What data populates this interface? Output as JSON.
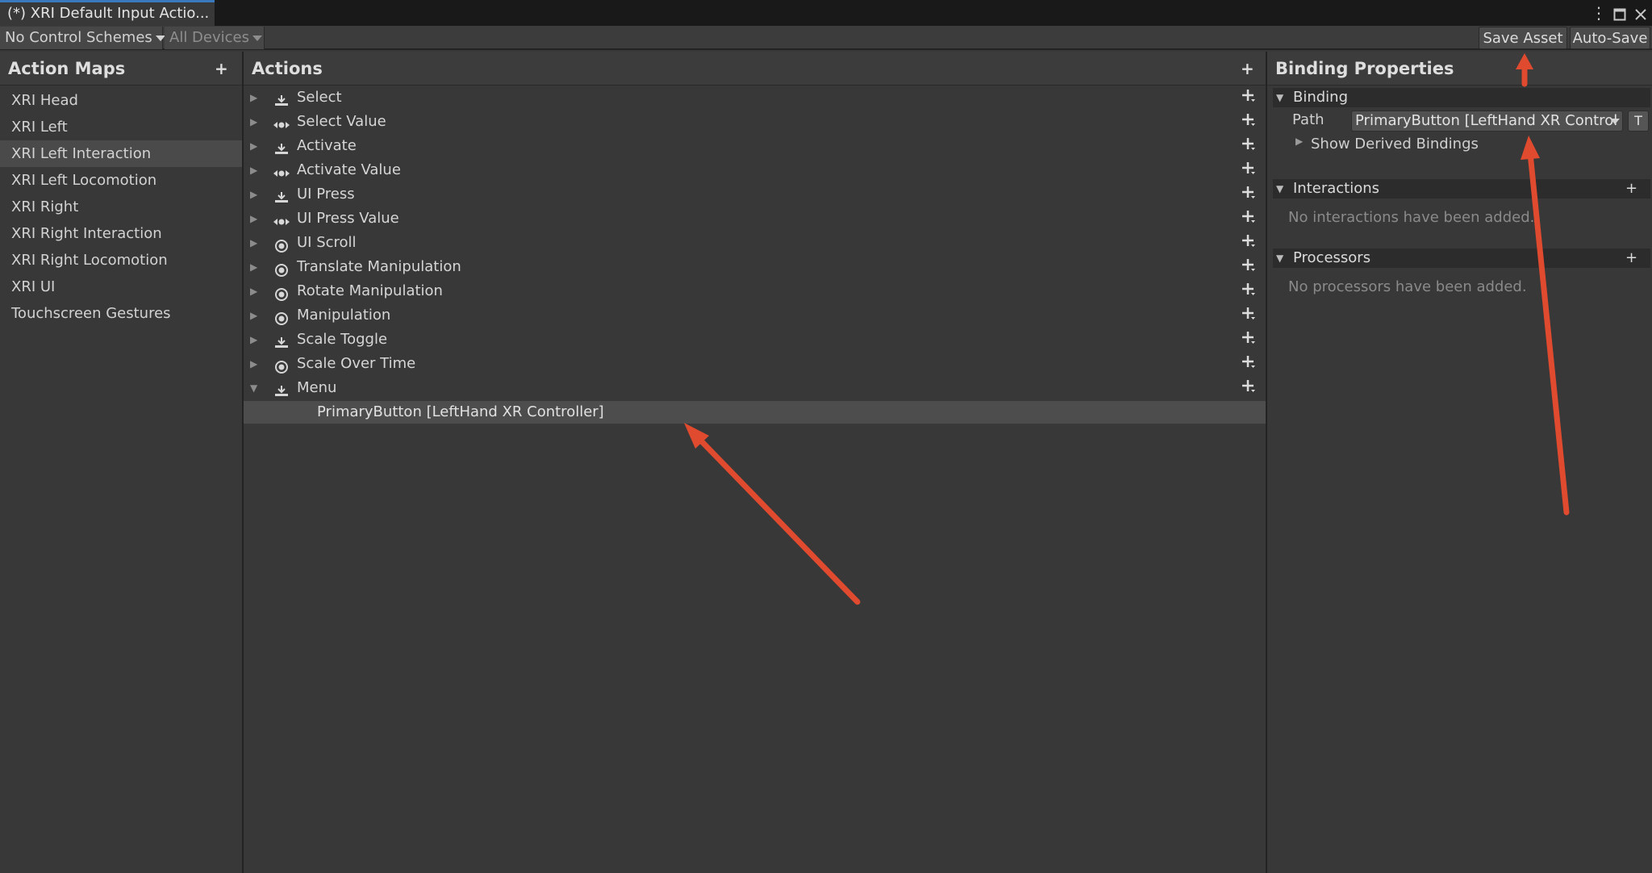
{
  "window": {
    "tab_title": "(*) XRI Default Input Actio...",
    "menu_icon": "kebab-menu-icon",
    "maximize_icon": "maximize-icon",
    "close_icon": "close-icon"
  },
  "toolbar": {
    "control_schemes": "No Control Schemes",
    "devices": "All Devices",
    "save_asset": "Save Asset",
    "auto_save": "Auto-Save"
  },
  "action_maps": {
    "title": "Action Maps",
    "add_label": "+",
    "items": [
      "XRI Head",
      "XRI Left",
      "XRI Left Interaction",
      "XRI Left Locomotion",
      "XRI Right",
      "XRI Right Interaction",
      "XRI Right Locomotion",
      "XRI UI",
      "Touchscreen Gestures"
    ],
    "selected_index": 2
  },
  "actions": {
    "title": "Actions",
    "add_label": "+",
    "items": [
      {
        "label": "Select",
        "icon": "button-icon",
        "expanded": false
      },
      {
        "label": "Select Value",
        "icon": "axis-icon",
        "expanded": false
      },
      {
        "label": "Activate",
        "icon": "button-icon",
        "expanded": false
      },
      {
        "label": "Activate Value",
        "icon": "axis-icon",
        "expanded": false
      },
      {
        "label": "UI Press",
        "icon": "button-icon",
        "expanded": false
      },
      {
        "label": "UI Press Value",
        "icon": "axis-icon",
        "expanded": false
      },
      {
        "label": "UI Scroll",
        "icon": "value-icon",
        "expanded": false
      },
      {
        "label": "Translate Manipulation",
        "icon": "value-icon",
        "expanded": false
      },
      {
        "label": "Rotate Manipulation",
        "icon": "value-icon",
        "expanded": false
      },
      {
        "label": "Manipulation",
        "icon": "value-icon",
        "expanded": false
      },
      {
        "label": "Scale Toggle",
        "icon": "button-icon",
        "expanded": false
      },
      {
        "label": "Scale Over Time",
        "icon": "value-icon",
        "expanded": false
      },
      {
        "label": "Menu",
        "icon": "button-icon",
        "expanded": true
      }
    ],
    "binding": "PrimaryButton [LeftHand XR Controller]"
  },
  "binding_properties": {
    "title": "Binding Properties",
    "binding_section": "Binding",
    "path_label": "Path",
    "path_value": "PrimaryButton [LeftHand XR Control",
    "t_button": "T",
    "show_derived": "Show Derived Bindings",
    "interactions_section": "Interactions",
    "interactions_empty": "No interactions have been added.",
    "processors_section": "Processors",
    "processors_empty": "No processors have been added.",
    "add_label": "+"
  },
  "colors": {
    "background": "#383838",
    "header": "#3c3c3c",
    "selected": "#4a4a4a",
    "annotation": "#e04a2f",
    "tab_accent": "#3a79bb"
  }
}
